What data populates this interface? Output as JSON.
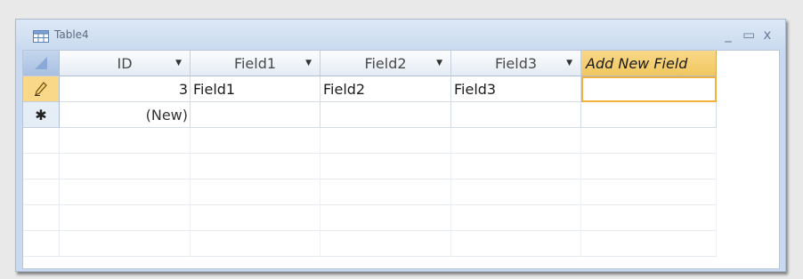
{
  "window": {
    "title": "Table4"
  },
  "controls": {
    "minimize": "_",
    "restore": "▭",
    "close": "x"
  },
  "columns": [
    {
      "label": "ID",
      "arrow": "▼"
    },
    {
      "label": "Field1",
      "arrow": "▼"
    },
    {
      "label": "Field2",
      "arrow": "▼"
    },
    {
      "label": "Field3",
      "arrow": "▼"
    }
  ],
  "add_new_field": "Add New Field",
  "record": {
    "id": "3",
    "field1": "Field1",
    "field2": "Field2",
    "field3": "Field3"
  },
  "new_row": {
    "marker": "✱",
    "id": "(New)"
  },
  "icons": {
    "edit_pencil": "pencil-icon",
    "table": "table-icon"
  },
  "colors": {
    "accent": "#f0c75f",
    "focus": "#f2b13c",
    "frame": "#c9daf0"
  }
}
